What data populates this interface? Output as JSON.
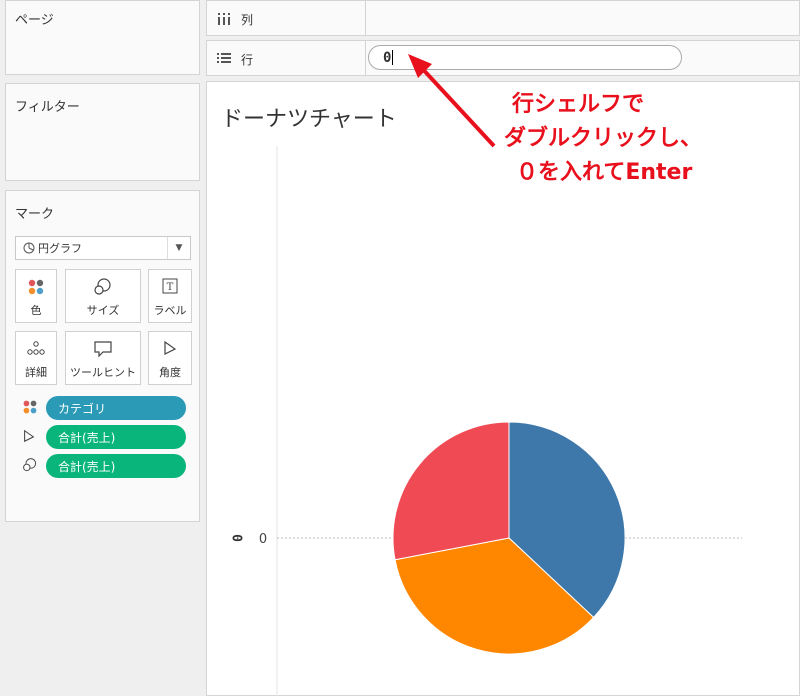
{
  "left_panels": {
    "pages_title": "ページ",
    "filters_title": "フィルター",
    "marks_title": "マーク"
  },
  "marks": {
    "mark_type": "円グラフ",
    "buttons": {
      "color": "色",
      "size": "サイズ",
      "label": "ラベル",
      "detail": "詳細",
      "tooltip": "ツールヒント",
      "angle": "角度"
    },
    "pills": [
      {
        "label": "カテゴリ",
        "role": "color",
        "color": "#2a9ab7"
      },
      {
        "label": "合計(売上)",
        "role": "angle",
        "color": "#09b57a"
      },
      {
        "label": "合計(売上)",
        "role": "size",
        "color": "#09b57a"
      }
    ]
  },
  "shelves": {
    "columns_label": "列",
    "rows_label": "行",
    "rows_value": "0"
  },
  "sheet_title": "ドーナツチャート",
  "annotation": {
    "lines": [
      "行シェルフで",
      "ダブルクリックし、",
      "０を入れてEnter"
    ],
    "color": "#e8101c"
  },
  "chart_data": {
    "type": "pie",
    "axis_field_label": "0",
    "axis_tick": "0",
    "slices": [
      {
        "value": 37,
        "color": "#3e78aa"
      },
      {
        "value": 35,
        "color": "#ff8700"
      },
      {
        "value": 28,
        "color": "#f04b55"
      }
    ]
  }
}
